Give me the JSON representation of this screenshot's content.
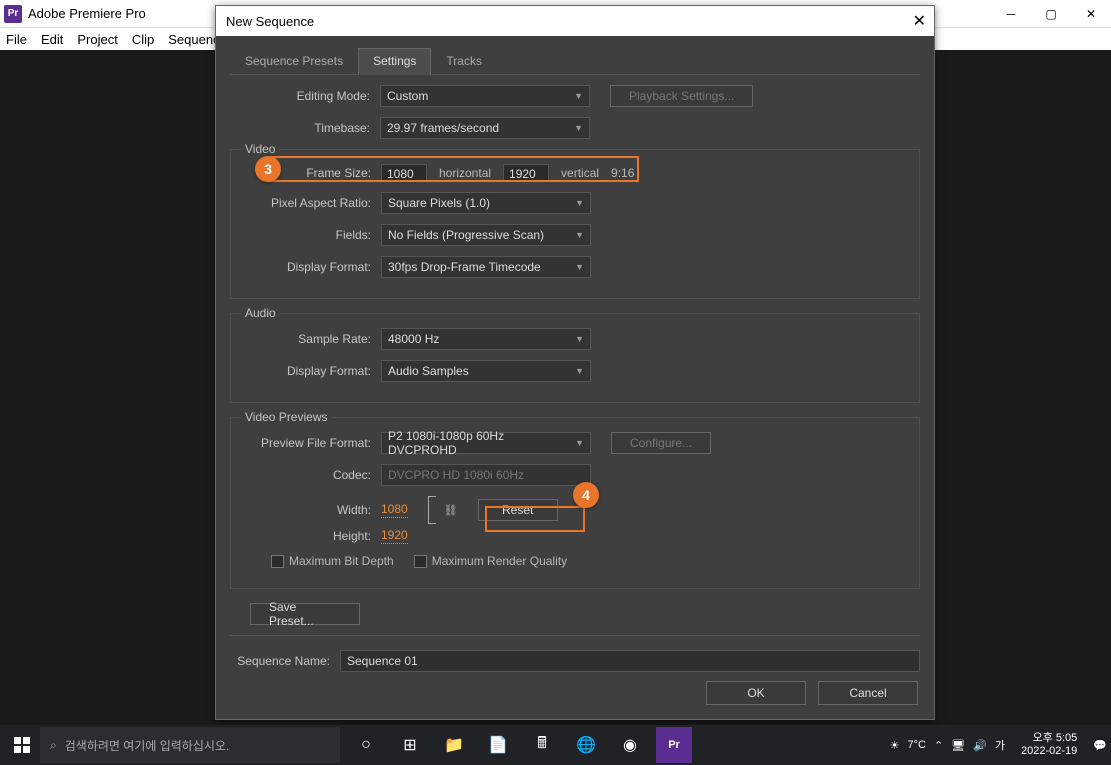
{
  "app": {
    "title": "Adobe Premiere Pro",
    "icon": "Pr"
  },
  "menu": [
    "File",
    "Edit",
    "Project",
    "Clip",
    "Sequence"
  ],
  "dialog": {
    "title": "New Sequence",
    "tabs": [
      "Sequence Presets",
      "Settings",
      "Tracks"
    ],
    "active_tab": 1,
    "editing_mode": {
      "label": "Editing Mode:",
      "value": "Custom"
    },
    "timebase": {
      "label": "Timebase:",
      "value": "29.97 frames/second"
    },
    "playback_button": "Playback Settings...",
    "video": {
      "legend": "Video",
      "frame_size": {
        "label": "Frame Size:",
        "h": "1080",
        "h_label": "horizontal",
        "v": "1920",
        "v_label": "vertical",
        "ratio": "9:16"
      },
      "par": {
        "label": "Pixel Aspect Ratio:",
        "value": "Square Pixels (1.0)"
      },
      "fields": {
        "label": "Fields:",
        "value": "No Fields (Progressive Scan)"
      },
      "display_format": {
        "label": "Display Format:",
        "value": "30fps Drop-Frame Timecode"
      }
    },
    "audio": {
      "legend": "Audio",
      "sample_rate": {
        "label": "Sample Rate:",
        "value": "48000 Hz"
      },
      "display_format": {
        "label": "Display Format:",
        "value": "Audio Samples"
      }
    },
    "previews": {
      "legend": "Video Previews",
      "file_format": {
        "label": "Preview File Format:",
        "value": "P2 1080i-1080p 60Hz DVCPROHD"
      },
      "configure": "Configure...",
      "codec": {
        "label": "Codec:",
        "value": "DVCPRO HD 1080i 60Hz"
      },
      "width": {
        "label": "Width:",
        "value": "1080"
      },
      "height": {
        "label": "Height:",
        "value": "1920"
      },
      "reset": "Reset",
      "max_bit_depth": "Maximum Bit Depth",
      "max_render_quality": "Maximum Render Quality"
    },
    "save_preset": "Save Preset...",
    "sequence_name": {
      "label": "Sequence Name:",
      "value": "Sequence 01"
    },
    "ok": "OK",
    "cancel": "Cancel"
  },
  "annotations": {
    "badge3": "3",
    "badge4": "4"
  },
  "taskbar": {
    "search_placeholder": "검색하려면 여기에 입력하십시오.",
    "weather": "7°C",
    "ime": "가",
    "time": "오후 5:05",
    "date": "2022-02-19"
  }
}
